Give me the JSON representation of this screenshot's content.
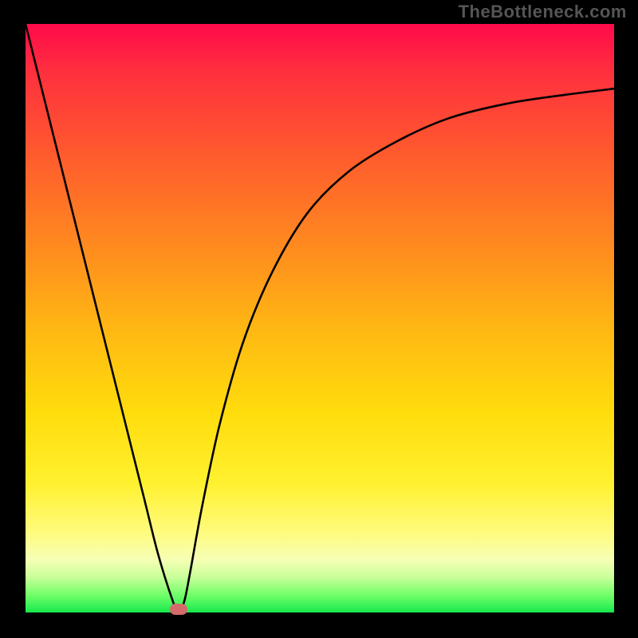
{
  "attribution": "TheBottleneck.com",
  "chart_data": {
    "type": "line",
    "title": "",
    "xlabel": "",
    "ylabel": "",
    "xlim": [
      0,
      100
    ],
    "ylim": [
      0,
      100
    ],
    "axis_ticks_hidden": true,
    "gradient_colors": {
      "top": "#ff0a4a",
      "mid_upper": "#ff8b1f",
      "mid": "#ffdc0c",
      "mid_lower": "#fffb7a",
      "bottom": "#17e84e"
    },
    "series": [
      {
        "name": "bottleneck-curve",
        "x": [
          0,
          5,
          10,
          15,
          20,
          22.5,
          25,
          26,
          27,
          28,
          30,
          33,
          37,
          42,
          48,
          55,
          63,
          72,
          82,
          92,
          100
        ],
        "y": [
          100,
          80,
          60,
          40,
          20,
          10,
          2,
          0,
          2,
          7,
          18,
          32,
          46,
          58,
          68,
          75,
          80,
          84,
          86.5,
          88,
          89
        ]
      }
    ],
    "marker": {
      "x": 26,
      "y": 0.5,
      "color": "#d46a6a"
    }
  }
}
